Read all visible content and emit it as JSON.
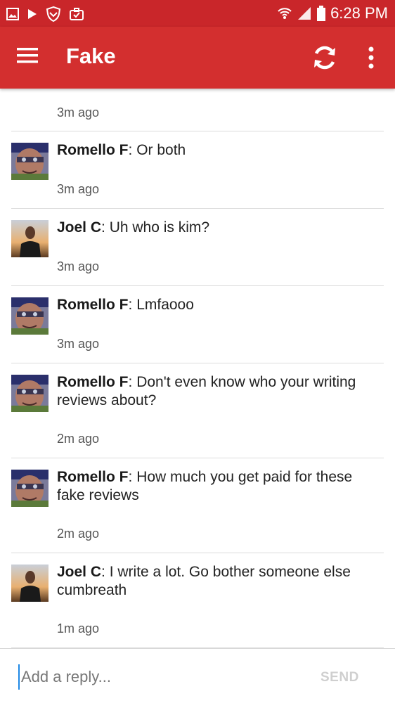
{
  "status_bar": {
    "time": "6:28 PM",
    "icons": [
      "image-icon",
      "play-icon",
      "shield-icon",
      "briefcase-icon",
      "wifi-icon",
      "signal-icon",
      "battery-icon"
    ]
  },
  "app_bar": {
    "title": "Fake",
    "color": "#d32f2f",
    "actions": [
      "menu-icon",
      "refresh-icon",
      "more-vert-icon"
    ]
  },
  "comments": [
    {
      "author": "",
      "separator": "",
      "text": "",
      "time": "3m ago",
      "avatar": ""
    },
    {
      "author": "Romello F",
      "separator": ":",
      "text": " Or both",
      "time": "3m ago",
      "avatar": "romello-avatar"
    },
    {
      "author": "Joel C",
      "separator": ":",
      "text": " Uh who is kim?",
      "time": "3m ago",
      "avatar": "joel-avatar"
    },
    {
      "author": "Romello F",
      "separator": ":",
      "text": " Lmfaooo",
      "time": "3m ago",
      "avatar": "romello-avatar"
    },
    {
      "author": "Romello F",
      "separator": ":",
      "text": " Don't even know who your writing reviews about?",
      "time": "2m ago",
      "avatar": "romello-avatar"
    },
    {
      "author": "Romello F",
      "separator": ":",
      "text": " How much you get paid for these fake reviews",
      "time": "2m ago",
      "avatar": "romello-avatar"
    },
    {
      "author": "Joel C",
      "separator": ":",
      "text": " I write a lot. Go bother someone else cumbreath",
      "time": "1m ago",
      "avatar": "joel-avatar"
    }
  ],
  "reply": {
    "placeholder": "Add a reply...",
    "value": "",
    "send_label": "SEND"
  }
}
